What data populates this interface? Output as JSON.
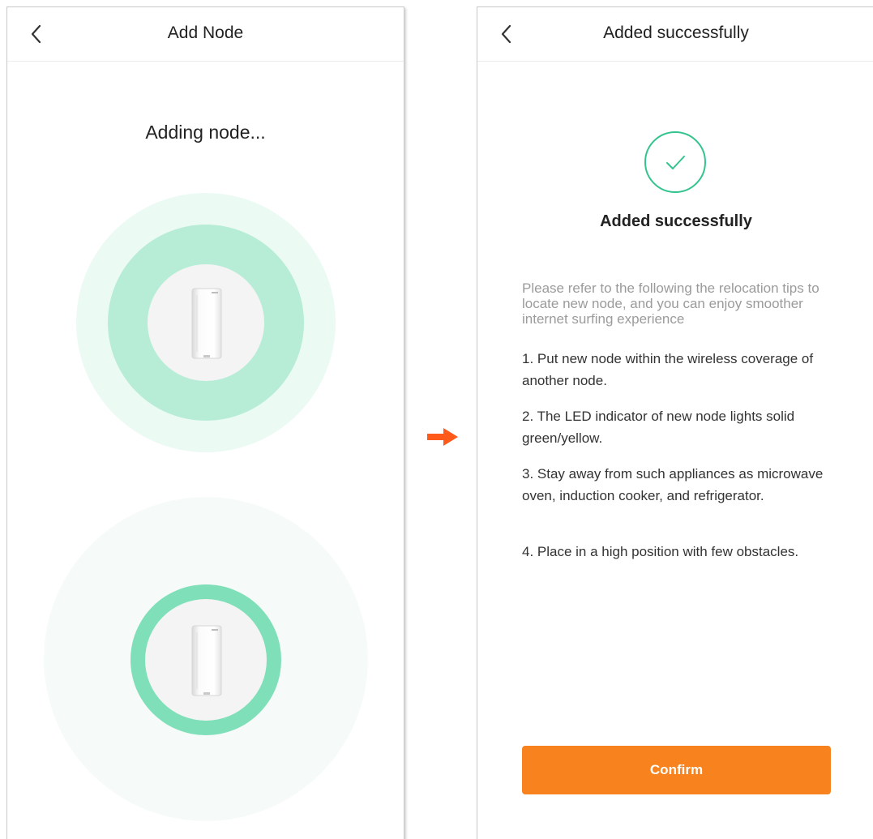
{
  "left_screen": {
    "title": "Add Node",
    "status_text": "Adding node..."
  },
  "right_screen": {
    "title": "Added successfully",
    "success_heading": "Added successfully",
    "intro": "Please refer to the following the relocation tips to locate new node, and you can enjoy smoother internet surfing experience",
    "tips": [
      "1. Put new node within the wireless coverage of another node.",
      "2. The LED indicator of new node lights solid green/yellow.",
      "3. Stay away from such appliances as microwave oven, induction cooker, and refrigerator.",
      "4. Place in a high position with few obstacles."
    ],
    "confirm_label": "Confirm"
  },
  "colors": {
    "accent_orange": "#f7821e",
    "arrow_orange": "#ff5a1a",
    "success_green": "#33c48e",
    "ring_green_strong": "#7fdfb9",
    "ring_green_light": "#b7edd7",
    "ring_green_faint": "#ecfaf4"
  },
  "icons": {
    "back": "chevron-left-icon",
    "success": "check-icon",
    "flow_arrow": "arrow-right-icon",
    "device": "mesh-node-device-icon"
  }
}
